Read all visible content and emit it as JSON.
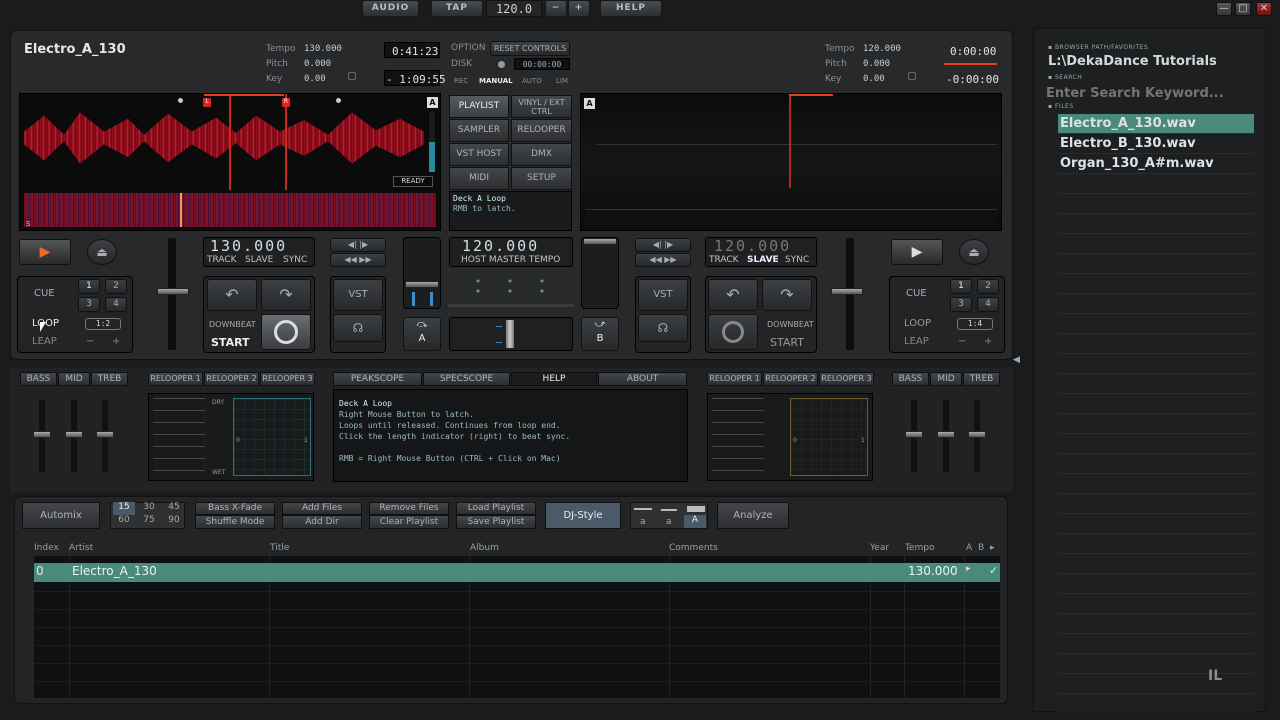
{
  "top": {
    "audio": "AUDIO",
    "tap": "TAP",
    "tempo": "120.0",
    "minus": "−",
    "plus": "+",
    "help": "HELP"
  },
  "win": {
    "min": "—",
    "max": "□",
    "close": "✕"
  },
  "deckA": {
    "title": "Electro_A_130",
    "tempo_label": "Tempo",
    "tempo": "130.000",
    "pitch_label": "Pitch",
    "pitch": "0.000",
    "key_label": "Key",
    "key": "0.00",
    "time": "0:41:23",
    "remain": "- 1:09:55",
    "ready": "READY",
    "bpm": "130.000",
    "track": "TRACK",
    "slave": "SLAVE",
    "sync": "SYNC",
    "cue": "CUE",
    "loop": "LOOP",
    "leap": "LEAP",
    "n1": "1",
    "n2": "2",
    "n3": "3",
    "n4": "4",
    "loop_len": "1:2",
    "minus": "−",
    "plus": "+",
    "downbeat": "DOWNBEAT",
    "start": "START",
    "vst": "VST",
    "badge": "A",
    "marker_l": "L",
    "marker_r": "R",
    "marker_s": "S"
  },
  "deckB": {
    "tempo_label": "Tempo",
    "tempo": "120.000",
    "pitch_label": "Pitch",
    "pitch": "0.000",
    "key_label": "Key",
    "key": "0.00",
    "time": "0:00:00",
    "remain": "-0:00:00",
    "bpm": "120.000",
    "track": "TRACK",
    "slave": "SLAVE",
    "sync": "SYNC",
    "cue": "CUE",
    "loop": "LOOP",
    "leap": "LEAP",
    "n1": "1",
    "n2": "2",
    "n3": "3",
    "n4": "4",
    "loop_len": "1:4",
    "minus": "−",
    "plus": "+",
    "downbeat": "DOWNBEAT",
    "start": "START",
    "vst": "VST",
    "badge": "A"
  },
  "center": {
    "option": "OPTION",
    "disk": "DISK",
    "reset": "RESET CONTROLS",
    "disk_time": "00:00:00",
    "rec": "REC",
    "manual": "MANUAL",
    "auto": "AUTO",
    "lim": "LIM",
    "playlist": "PLAYLIST",
    "vinyl": "VINYL / EXT CTRL",
    "sampler": "SAMPLER",
    "relooper": "RELOOPER",
    "vsthost": "VST HOST",
    "dmx": "DMX",
    "midi": "MIDI",
    "setup": "SETUP",
    "info1": "Deck A Loop",
    "info2": "RMB to latch.",
    "master_bpm": "120.000",
    "host_master": "HOST MASTER TEMPO",
    "xa": "A",
    "xb": "B"
  },
  "fx": {
    "bass": "BASS",
    "mid": "MID",
    "treb": "TREB",
    "r1": "RELOOPER 1",
    "r2": "RELOOPER 2",
    "r3": "RELOOPER 3",
    "dry": "DRY",
    "wet": "WET",
    "zero": "0",
    "one": "1"
  },
  "help_tabs": {
    "peakscope": "PEAKSCOPE",
    "specscope": "SPECSCOPE",
    "help": "HELP",
    "about": "ABOUT"
  },
  "help_text": {
    "l1": "Deck A Loop",
    "l2": "Right Mouse Button to latch.",
    "l3": "Loops until released. Continues from loop end.",
    "l4": "Click the length indicator (right) to beat sync.",
    "l5": "RMB = Right Mouse Button  (CTRL + Click on Mac)"
  },
  "playlist_bar": {
    "automix": "Automix",
    "t15": "15",
    "t30": "30",
    "t45": "45",
    "t60": "60",
    "t75": "75",
    "t90": "90",
    "bass_xfade": "Bass X-Fade",
    "shuffle": "Shuffle Mode",
    "add_files": "Add Files",
    "add_dir": "Add Dir",
    "remove_files": "Remove Files",
    "clear_playlist": "Clear Playlist",
    "load_playlist": "Load Playlist",
    "save_playlist": "Save Playlist",
    "djstyle": "DJ-Style",
    "a1": "a",
    "a2": "a",
    "a3": "A",
    "analyze": "Analyze"
  },
  "columns": {
    "index": "Index",
    "artist": "Artist",
    "title": "Title",
    "album": "Album",
    "comments": "Comments",
    "year": "Year",
    "tempo": "Tempo",
    "a": "A",
    "b": "B",
    "arrow": "▸"
  },
  "rows": [
    {
      "index": "0",
      "artist": "Electro_A_130",
      "tempo": "130.000"
    }
  ],
  "browser": {
    "path_label": "BROWSER PATH/FAVORITES",
    "path": "L:\\DekaDance Tutorials",
    "search_label": "SEARCH",
    "search_placeholder": "Enter Search Keyword...",
    "files_label": "FILES",
    "files": [
      "Electro_A_130.wav",
      "Electro_B_130.wav",
      "Organ_130_A#m.wav"
    ]
  }
}
